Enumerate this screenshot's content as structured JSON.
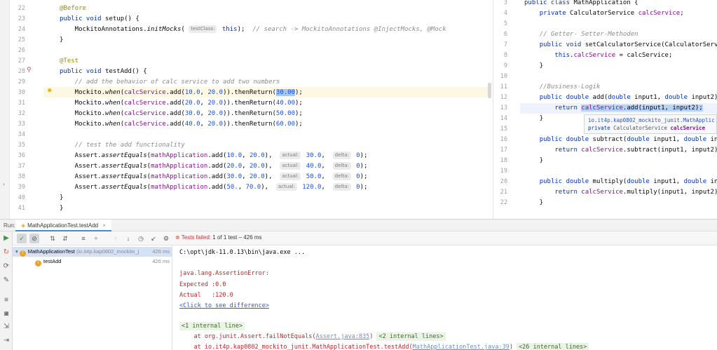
{
  "editor_left": {
    "lines": [
      {
        "n": "22",
        "html": "<span class=\"an\">@Before</span>"
      },
      {
        "n": "23",
        "html": "<span class=\"kw\">public void</span> setup() {"
      },
      {
        "n": "24",
        "html": "    MockitoAnnotations.<span class=\"it\">initMocks</span>( <span class=\"hint\">testClass:</span> <span class=\"kw\">this</span>);  <span class=\"cm\">// search -&gt; MockitoAnnotations @InjectMocks, @Mock</span>"
      },
      {
        "n": "25",
        "html": "}"
      },
      {
        "n": "26",
        "html": ""
      },
      {
        "n": "27",
        "html": "<span class=\"an\">@Test</span>"
      },
      {
        "n": "28",
        "html": "<span class=\"kw\">public void</span> testAdd() {"
      },
      {
        "n": "29",
        "html": "    <span class=\"cm\">// add the behavior of calc service to add two numbers</span>"
      },
      {
        "n": "30",
        "html": "    Mockito.<span class=\"it\">when</span>(<span class=\"fld\">calcService</span>.add(<span class=\"num\">10.0</span>, <span class=\"num\">20.0</span>)).thenReturn(<span class=\"num sel\">30.00</span>);"
      },
      {
        "n": "31",
        "html": "    Mockito.<span class=\"it\">when</span>(<span class=\"fld\">calcService</span>.add(<span class=\"num\">20.0</span>, <span class=\"num\">20.0</span>)).thenReturn(<span class=\"num\">40.00</span>);"
      },
      {
        "n": "32",
        "html": "    Mockito.<span class=\"it\">when</span>(<span class=\"fld\">calcService</span>.add(<span class=\"num\">30.0</span>, <span class=\"num\">20.0</span>)).thenReturn(<span class=\"num\">50.00</span>);"
      },
      {
        "n": "33",
        "html": "    Mockito.<span class=\"it\">when</span>(<span class=\"fld\">calcService</span>.add(<span class=\"num\">40.0</span>, <span class=\"num\">20.0</span>)).thenReturn(<span class=\"num\">60.00</span>);"
      },
      {
        "n": "34",
        "html": ""
      },
      {
        "n": "35",
        "html": "    <span class=\"cm\">// test the add functionality</span>"
      },
      {
        "n": "36",
        "html": "    Assert.<span class=\"it\">assertEquals</span>(<span class=\"fld\">mathApplication</span>.add(<span class=\"num\">10.0</span>, <span class=\"num\">20.0</span>),  <span class=\"hint\">actual:</span> <span class=\"num\">30.0</span>,  <span class=\"hint\">delta:</span> <span class=\"num\">0</span>);"
      },
      {
        "n": "37",
        "html": "    Assert.<span class=\"it\">assertEquals</span>(<span class=\"fld\">mathApplication</span>.add(<span class=\"num\">20.0</span>, <span class=\"num\">20.0</span>),  <span class=\"hint\">actual:</span> <span class=\"num\">40.0</span>,  <span class=\"hint\">delta:</span> <span class=\"num\">0</span>);"
      },
      {
        "n": "38",
        "html": "    Assert.<span class=\"it\">assertEquals</span>(<span class=\"fld\">mathApplication</span>.add(<span class=\"num\">30.0</span>, <span class=\"num\">20.0</span>),  <span class=\"hint\">actual:</span> <span class=\"num\">50.0</span>,  <span class=\"hint\">delta:</span> <span class=\"num\">0</span>);"
      },
      {
        "n": "39",
        "html": "    Assert.<span class=\"it\">assertEquals</span>(<span class=\"fld\">mathApplication</span>.add(<span class=\"num\">50.</span>, <span class=\"num\">70.0</span>),  <span class=\"hint\">actual:</span> <span class=\"num\">120.0</span>,  <span class=\"hint\">delta:</span> <span class=\"num\">0</span>);"
      },
      {
        "n": "40",
        "html": "}"
      },
      {
        "n": "41",
        "html": "}"
      }
    ]
  },
  "editor_right": {
    "lines": [
      {
        "n": "3",
        "html": "<span class=\"kw\">public class</span> MathApplication {"
      },
      {
        "n": "4",
        "html": "    <span class=\"kw\">private</span> CalculatorService <span class=\"fld\">calcService</span>;"
      },
      {
        "n": "5",
        "html": ""
      },
      {
        "n": "6",
        "html": "    <span class=\"cm\">// Getter- Setter-Methoden</span>"
      },
      {
        "n": "7",
        "html": "    <span class=\"kw\">public void</span> setCalculatorService(CalculatorServ"
      },
      {
        "n": "8",
        "html": "        <span class=\"kw\">this</span>.<span class=\"fld\">calcService</span> = calcService;"
      },
      {
        "n": "9",
        "html": "    }"
      },
      {
        "n": "10",
        "html": ""
      },
      {
        "n": "11",
        "html": "    <span class=\"cm\">//Business-Logik</span>"
      },
      {
        "n": "12",
        "html": "    <span class=\"kw\">public double</span> add(<span class=\"kw\">double</span> input1, <span class=\"kw\">double</span> input2)"
      },
      {
        "n": "13",
        "html": "        <span class=\"kw\">return</span> <span class=\"fld selr\">calcService</span><span class=\"selr\">.add(input1, input2);</span>"
      },
      {
        "n": "14",
        "html": "    }"
      },
      {
        "n": "15",
        "html": ""
      },
      {
        "n": "16",
        "html": "    <span class=\"kw\">public double</span> subtract(<span class=\"kw\">double</span> input1, <span class=\"kw\">double</span> in"
      },
      {
        "n": "17",
        "html": "        <span class=\"kw\">return</span> <span class=\"fld\">calcService</span>.subtract(input1, input2);"
      },
      {
        "n": "18",
        "html": "    }"
      },
      {
        "n": "19",
        "html": ""
      },
      {
        "n": "20",
        "html": "    <span class=\"kw\">public double</span> multiply(<span class=\"kw\">double</span> input1, <span class=\"kw\">double</span> in"
      },
      {
        "n": "21",
        "html": "        <span class=\"kw\">return</span> <span class=\"fld\">calcService</span>.multiply(input1, input2);"
      },
      {
        "n": "22",
        "html": "    }"
      }
    ],
    "tooltip": {
      "line1": "io.it4p.kap0802_mockito_junit.MathApplic",
      "line2_kw": "private",
      "line2_type": "CalculatorService",
      "line2_field": "calcService"
    }
  },
  "run_panel": {
    "label": "Run:",
    "tab": "MathApplicationTest.testAdd",
    "status_prefix": "Tests failed:",
    "status_detail": "1 of 1 test – 426 ms"
  },
  "tree": {
    "root": {
      "name": "MathApplicationTest",
      "pkg": "(io.it4p.kap0802_mockito_j",
      "time": "426 ms"
    },
    "child": {
      "name": "testAdd",
      "time": "426 ms"
    }
  },
  "console": {
    "cmd": "C:\\opt\\jdk-11.0.13\\bin\\java.exe ...",
    "error": "java.lang.AssertionError:",
    "expected": "Expected :0.0",
    "actual": "Actual   :120.0",
    "diff_link": "<Click to see difference>",
    "fold1": "<1 internal line>",
    "at1_prefix": "    at org.junit.Assert.failNotEquals(",
    "at1_link": "Assert.java:835",
    "at1_suffix": ") ",
    "fold2": "<2 internal lines>",
    "at2_prefix": "    at io.it4p.kap0802_mockito_junit.MathApplicationTest.testAdd(",
    "at2_link": "MathApplicationTest.java:39",
    "at2_suffix": ") ",
    "fold3": "<26 internal lines>"
  },
  "colors": {
    "keyword": "#0033b3",
    "annotation": "#9e880d",
    "number": "#1750eb",
    "field": "#871094",
    "comment": "#8c8c8c",
    "error": "#c02525"
  }
}
